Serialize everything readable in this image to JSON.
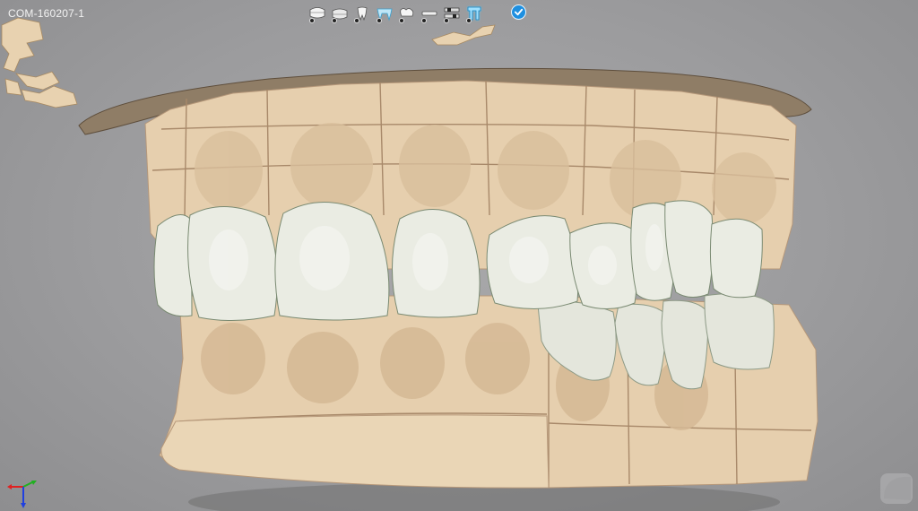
{
  "case_id": "COM-160207-1",
  "toolbar": {
    "tools": [
      {
        "icon": "upper-jaw-model-icon"
      },
      {
        "icon": "lower-jaw-model-icon"
      },
      {
        "icon": "single-tooth-icon"
      },
      {
        "icon": "bridge-icon"
      },
      {
        "icon": "crown-icon"
      },
      {
        "icon": "connector-icon"
      },
      {
        "icon": "sliders-icon"
      },
      {
        "icon": "implant-icon"
      }
    ],
    "active_tool": "implant-icon"
  },
  "confirm_icon": "checkmark-icon",
  "axis": {
    "x_color": "#e02020",
    "y_color": "#20b020",
    "z_color": "#2040e0"
  },
  "colors": {
    "model": "#e6cfae",
    "tooth": "#e8ebe2",
    "accent": "#1e8fe0"
  }
}
